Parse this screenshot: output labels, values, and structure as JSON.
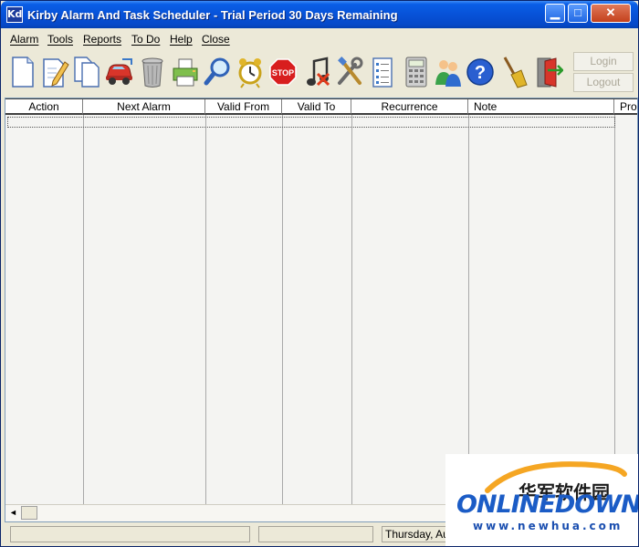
{
  "window": {
    "app_icon_text": "Kd",
    "title": "Kirby Alarm And Task Scheduler - Trial Period 30 Days Remaining",
    "min_symbol": "▁",
    "max_symbol": "□",
    "close_symbol": "✕"
  },
  "menu": {
    "items": [
      "Alarm",
      "Tools",
      "Reports",
      "To Do",
      "Help",
      "Close"
    ]
  },
  "toolbar": {
    "icons": [
      "new-document-icon",
      "edit-document-icon",
      "copy-document-icon",
      "car-icon",
      "trash-can-icon",
      "printer-icon",
      "magnifier-icon",
      "alarm-clock-icon",
      "stop-sign-icon",
      "music-note-icon",
      "tools-icon",
      "list-icon",
      "calculator-icon",
      "users-icon",
      "help-icon",
      "broom-icon",
      "exit-door-icon"
    ],
    "stop_text": "STOP",
    "help_text": "?",
    "login_label": "Login",
    "logout_label": "Logout"
  },
  "grid": {
    "columns": [
      "Action",
      "Next Alarm",
      "Valid From",
      "Valid To",
      "Recurrence",
      "Note",
      "Pro"
    ],
    "scroll_left_symbol": "◄"
  },
  "status": {
    "date_text": "Thursday, Au"
  },
  "watermark": {
    "cn_text": "华军软件园",
    "brand": "ONLINEDOWN",
    "url": "www.newhua.com"
  },
  "colors": {
    "title_bar": "#0752d8",
    "window_face": "#ece9d8",
    "grid_bg": "#f4f4f2",
    "watermark_blue": "#1b5cc6",
    "watermark_orange": "#f5a623"
  }
}
